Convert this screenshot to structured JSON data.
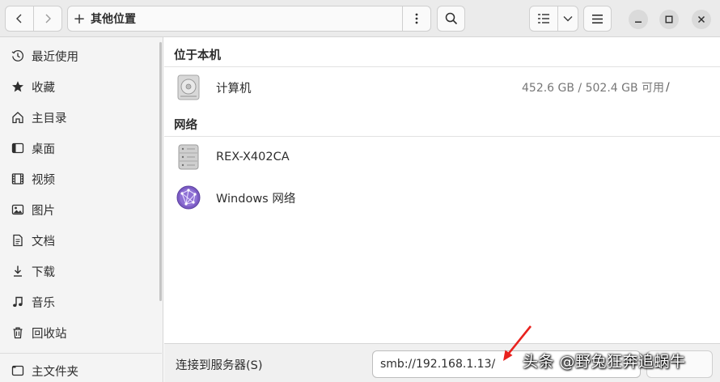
{
  "header": {
    "path_label": "其他位置"
  },
  "sidebar": {
    "items": [
      {
        "label": "最近使用",
        "icon": "clock-icon"
      },
      {
        "label": "收藏",
        "icon": "star-icon"
      },
      {
        "label": "主目录",
        "icon": "home-icon"
      },
      {
        "label": "桌面",
        "icon": "desktop-icon"
      },
      {
        "label": "视频",
        "icon": "video-icon"
      },
      {
        "label": "图片",
        "icon": "image-icon"
      },
      {
        "label": "文档",
        "icon": "document-icon"
      },
      {
        "label": "下载",
        "icon": "download-icon"
      },
      {
        "label": "音乐",
        "icon": "music-icon"
      },
      {
        "label": "回收站",
        "icon": "trash-icon"
      }
    ],
    "bottom_item": {
      "label": "主文件夹",
      "icon": "folder-icon"
    }
  },
  "main": {
    "local_section": "位于本机",
    "computer": {
      "name": "计算机",
      "info": "452.6 GB / 502.4 GB 可用",
      "path": "/"
    },
    "network_section": "网络",
    "network_items": [
      {
        "name": "REX-X402CA",
        "icon": "server-icon"
      },
      {
        "name": "Windows 网络",
        "icon": "network-globe-icon"
      }
    ]
  },
  "bottom": {
    "connect_label": "连接到服务器(S)",
    "server_value": "smb://192.168.1.13/"
  },
  "watermark": "头条 @野兔狂奔追蜗牛",
  "colors": {
    "accent_arrow": "#e8221e",
    "globe": "#7c5cc4"
  }
}
